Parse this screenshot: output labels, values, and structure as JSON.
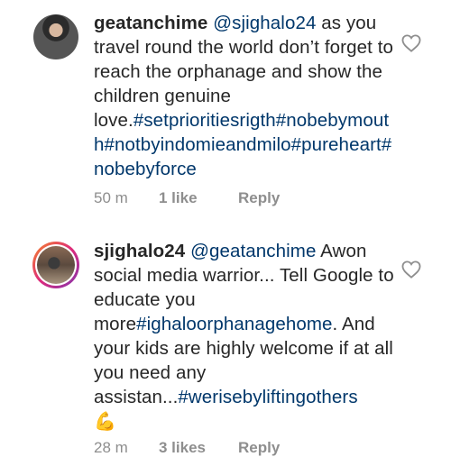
{
  "comments": [
    {
      "username": "geatanchime",
      "mention": "@sjighalo24",
      "text": " as you travel round the world don’t forget to reach the orphanage and show the children genuine love.",
      "hashtags": "#setprioritiesrigth#nobebymouth#notbyindomieandmilo#pureheart#nobebyforce",
      "time": "50 m",
      "likes": "1 like",
      "reply": "Reply"
    },
    {
      "username": "sjighalo24",
      "mention": "@geatanchime",
      "text_1": " Awon social media warrior... Tell Google to educate you more",
      "hashtag_1": "#ighaloorphanagehome",
      "text_2": ". And your kids are highly welcome if at all you need any assistan...",
      "hashtag_2": "#weriseby liftingothers",
      "emoji": "💪",
      "time": "28 m",
      "likes": "3 likes",
      "reply": "Reply"
    }
  ],
  "colors": {
    "link": "#00376b",
    "meta": "#8e8e8e",
    "text": "#262626"
  },
  "icons": {
    "like": "heart-outline-icon"
  }
}
